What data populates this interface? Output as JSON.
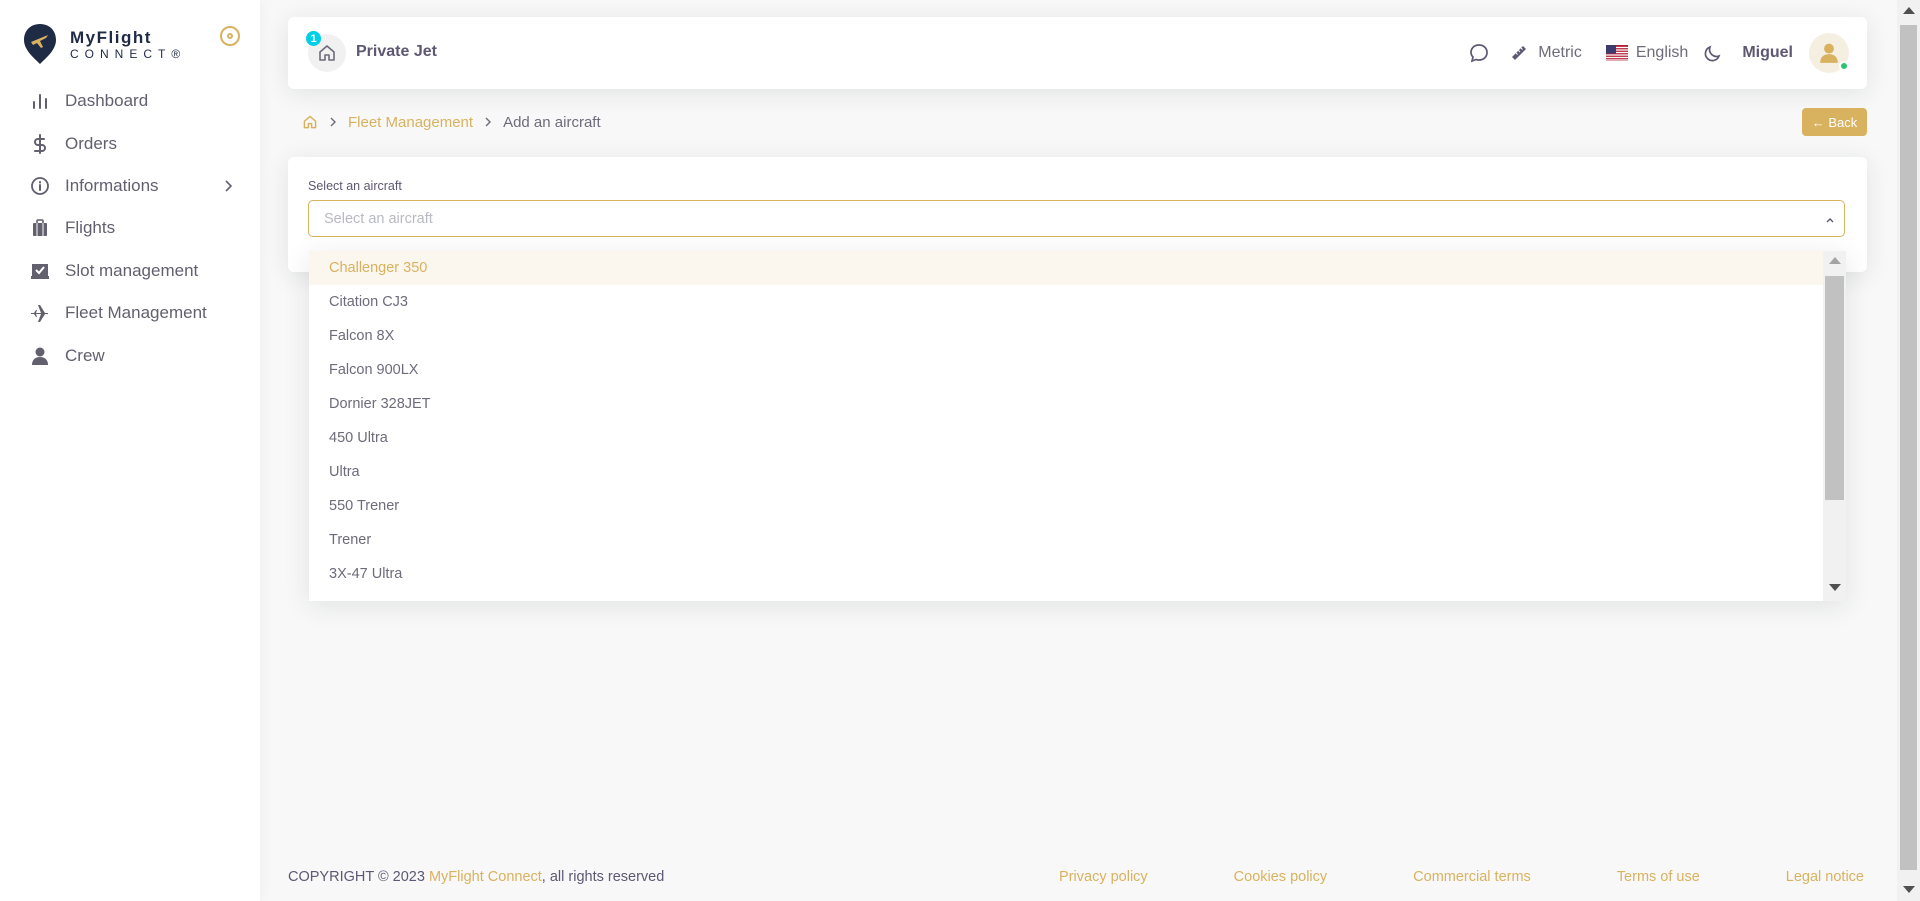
{
  "brand": {
    "name": "MyFlight",
    "sub": "CONNECT®"
  },
  "sidebar": {
    "items": [
      {
        "label": "Dashboard",
        "icon": "bar-chart-icon"
      },
      {
        "label": "Orders",
        "icon": "dollar-icon"
      },
      {
        "label": "Informations",
        "icon": "info-icon",
        "has_children": true
      },
      {
        "label": "Flights",
        "icon": "luggage-icon"
      },
      {
        "label": "Slot management",
        "icon": "calendar-check-icon"
      },
      {
        "label": "Fleet Management",
        "icon": "plane-icon"
      },
      {
        "label": "Crew",
        "icon": "user-icon"
      }
    ]
  },
  "navbar": {
    "notification_count": "1",
    "account": "Private Jet",
    "units": "Metric",
    "language": "English",
    "user": "Miguel"
  },
  "breadcrumb": {
    "parent": "Fleet Management",
    "current": "Add an aircraft",
    "back_label": "← Back"
  },
  "form": {
    "label": "Select an aircraft",
    "placeholder": "Select an aircraft",
    "options": [
      "Challenger 350",
      "Citation CJ3",
      "Falcon 8X",
      "Falcon 900LX",
      "Dornier 328JET",
      "450 Ultra",
      "Ultra",
      "550 Trener",
      "Trener",
      "3X-47 Ultra"
    ],
    "highlighted_option": "Challenger 350"
  },
  "footer": {
    "copyright_prefix": "COPYRIGHT © 2023 ",
    "brand_link": "MyFlight Connect",
    "copyright_suffix": ", all rights reserved",
    "links": [
      "Privacy policy",
      "Cookies policy",
      "Commercial terms",
      "Terms of use",
      "Legal notice"
    ]
  },
  "colors": {
    "accent": "#d9b25f",
    "badge": "#00cfe8",
    "online": "#28c76f",
    "text": "#5e5873"
  }
}
